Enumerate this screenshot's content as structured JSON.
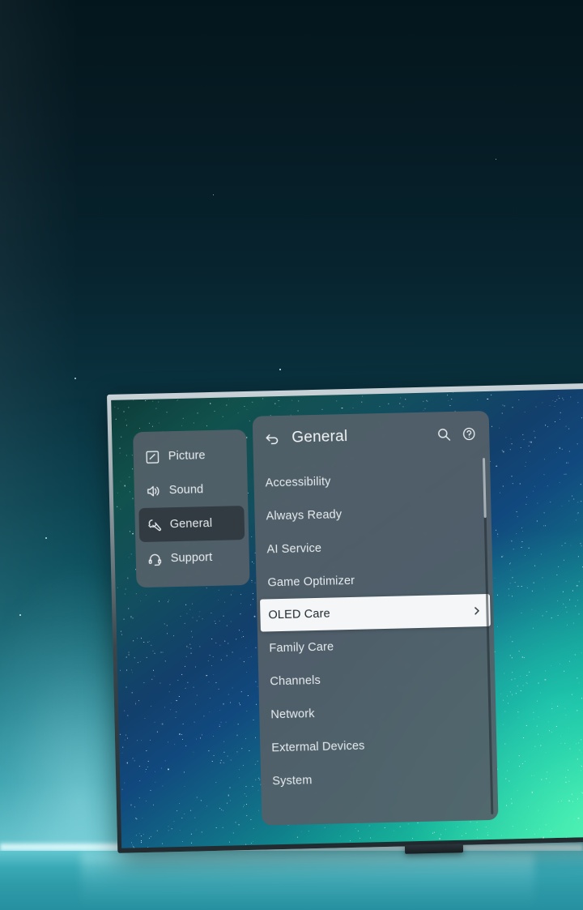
{
  "scene": {
    "device": "tv-settings-overlay",
    "wallpaper": "starfield-aurora"
  },
  "settings": {
    "rail": {
      "items": [
        {
          "label": "Picture",
          "icon": "picture-icon",
          "active": false
        },
        {
          "label": "Sound",
          "icon": "speaker-icon",
          "active": false
        },
        {
          "label": "General",
          "icon": "wrench-icon",
          "active": true
        },
        {
          "label": "Support",
          "icon": "headset-icon",
          "active": false
        }
      ]
    },
    "detail": {
      "back_icon": "back-arrow-icon",
      "title": "General",
      "actions": [
        {
          "name": "search-icon",
          "label": "Search"
        },
        {
          "name": "help-icon",
          "label": "Help"
        }
      ],
      "items": [
        {
          "label": "Accessibility",
          "selected": false,
          "chevron": false
        },
        {
          "label": "Always Ready",
          "selected": false,
          "chevron": false
        },
        {
          "label": "AI Service",
          "selected": false,
          "chevron": false
        },
        {
          "label": "Game Optimizer",
          "selected": false,
          "chevron": false
        },
        {
          "label": "OLED Care",
          "selected": true,
          "chevron": true
        },
        {
          "label": "Family Care",
          "selected": false,
          "chevron": false
        },
        {
          "label": "Channels",
          "selected": false,
          "chevron": false
        },
        {
          "label": "Network",
          "selected": false,
          "chevron": false
        },
        {
          "label": "Extermal Devices",
          "selected": false,
          "chevron": false
        },
        {
          "label": "System",
          "selected": false,
          "chevron": false
        }
      ]
    }
  },
  "colors": {
    "panel": "#546068",
    "panel_active": "#2f383f",
    "selected_bg": "#f4f6f7",
    "selected_text": "#20282d",
    "text": "#e7ecee",
    "floor_glow": "#ebfdff",
    "room_teal": "#2e9aa8"
  }
}
